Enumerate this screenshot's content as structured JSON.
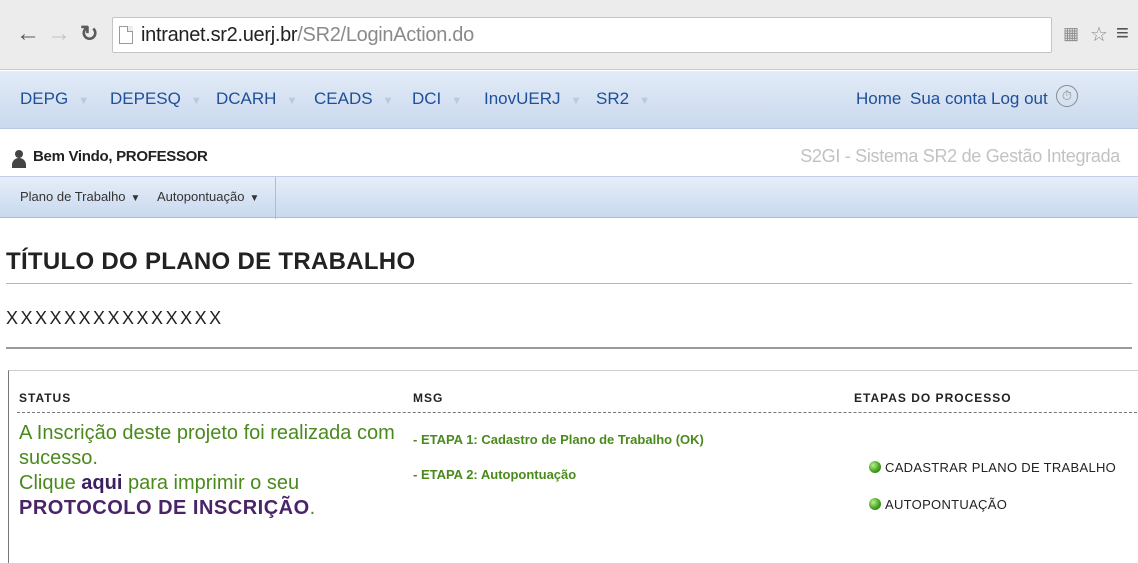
{
  "browser": {
    "url_host": "intranet.sr2.uerj.br",
    "url_path": "/SR2/LoginAction.do",
    "icons": [
      "back-arrow-icon",
      "forward-arrow-icon",
      "reload-icon",
      "page-icon",
      "extension-icon",
      "star-icon",
      "menu-icon"
    ]
  },
  "topnav": {
    "items": [
      "DEPG",
      "DEPESQ",
      "DCARH",
      "CEADS",
      "DCI",
      "InovUERJ",
      "SR2"
    ],
    "right": [
      "Home",
      "Sua conta",
      "Log out"
    ]
  },
  "welcome": {
    "text": "Bem Vindo, PROFESSOR",
    "system_name": "S2GI - Sistema SR2 de Gestão Integrada"
  },
  "submenu": {
    "items": [
      "Plano de Trabalho",
      "Autopontuação"
    ]
  },
  "content": {
    "title": "TÍTULO DO PLANO DE TRABALHO",
    "subtitle": "XXXXXXXXXXXXXXX"
  },
  "panel": {
    "headers": {
      "status": "STATUS",
      "msg": "MSG",
      "etapas": "ETAPAS DO PROCESSO"
    },
    "status": {
      "line1": "A Inscrição deste projeto foi realizada com sucesso.",
      "click_prefix": "Clique ",
      "click_link": "aqui",
      "click_suffix": " para imprimir o seu",
      "protocol_link": "PROTOCOLO DE INSCRIÇÃO",
      "period": "."
    },
    "messages": [
      "- ETAPA 1: Cadastro de Plano de Trabalho (OK)",
      "- ETAPA 2: Autopontuação"
    ],
    "etapas": [
      "CADASTRAR PLANO DE TRABALHO",
      "AUTOPONTUAÇÃO"
    ]
  },
  "colors": {
    "nav_link": "#1f4f98",
    "success_green": "#4a8a1c",
    "link_purple": "#4a2468"
  }
}
